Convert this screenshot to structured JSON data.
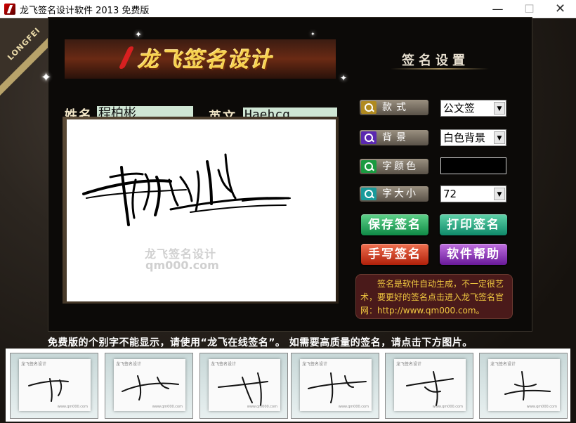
{
  "window": {
    "title": "龙飞签名设计软件 2013 免费版",
    "min_glyph": "—",
    "max_glyph": "☐",
    "close_glyph": "✕"
  },
  "brand": {
    "ribbon_text": "LONGFEI",
    "logo_text": "龙飞签名设计"
  },
  "form": {
    "name_label": "姓名",
    "name_value": "程柏彬",
    "english_label": "英文",
    "english_value": "Haehcg"
  },
  "preview": {
    "watermark_cn": "龙飞签名设计",
    "watermark_url": "qm000.com"
  },
  "settings": {
    "title": "签名设置",
    "style_label": "款式",
    "style_value": "公文签",
    "background_label": "背景",
    "background_value": "白色背景",
    "color_label": "字颜色",
    "color_value": "#000000",
    "size_label": "字大小",
    "size_value": "72",
    "arrow_glyph": "▼"
  },
  "actions": {
    "save": "保存签名",
    "print": "打印签名",
    "handwrite": "手写签名",
    "help": "软件帮助"
  },
  "info_text": "签名是软件自动生成，不一定很艺术，要更好的签名点击进入龙飞签名官网：http://www.qm000.com。",
  "notice": "免费版的个别字不能显示，请使用“龙飞在线签名”。 如需要高质量的签名，请点击下方图片。",
  "thumbnails": [
    {
      "brand": "龙飞签名设计",
      "url": "www.qm000.com"
    },
    {
      "brand": "龙飞签名设计",
      "url": "www.qm000.com"
    },
    {
      "brand": "龙飞签名设计",
      "url": "www.qm000.com"
    },
    {
      "brand": "龙飞签名设计",
      "url": "www.qm000.com"
    },
    {
      "brand": "龙飞签名设计",
      "url": "www.qm000.com"
    },
    {
      "brand": "龙飞签名设计",
      "url": "www.qm000.com"
    }
  ],
  "colors": {
    "gold": "#f7d250",
    "field_bg": "#cfe6d4",
    "info_text": "#f0c840"
  },
  "icons": {
    "button_icon": "magnifier-icon",
    "sparkle": "sparkle-icon"
  }
}
